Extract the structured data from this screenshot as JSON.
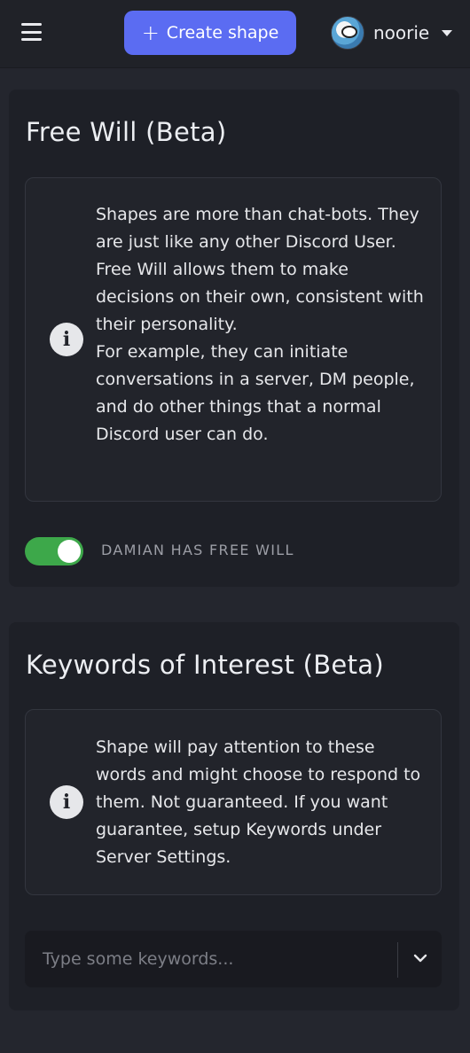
{
  "header": {
    "create_label": "Create shape",
    "username": "noorie",
    "menu_icon": "hamburger-icon",
    "avatar_icon": "user-avatar",
    "accent_color": "#5b6cf2"
  },
  "free_will": {
    "title": "Free Will (Beta)",
    "info_lines": [
      "Shapes are more than chat-bots. They are just like any other Discord User.",
      "Free Will allows them to make decisions on their own, consistent with their personality.",
      "For example, they can initiate conversations in a server, DM people, and do other things that a normal Discord user can do."
    ],
    "toggle_label": "DAMIAN HAS FREE WILL",
    "toggle_on": true,
    "toggle_color": "#3da84a"
  },
  "keywords": {
    "title": "Keywords of Interest (Beta)",
    "info_text": "Shape will pay attention to these words and might choose to respond to them. Not guaranteed. If you want guarantee, setup Keywords under Server Settings.",
    "placeholder": "Type some keywords...",
    "value": ""
  }
}
